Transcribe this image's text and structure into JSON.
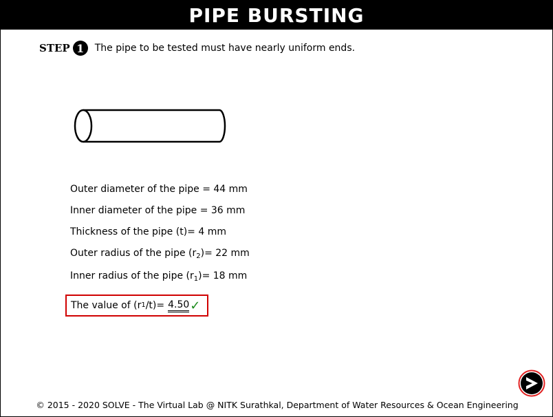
{
  "header": {
    "title": "PIPE BURSTING"
  },
  "step": {
    "word": "STEP",
    "number": "1",
    "instruction": "The pipe to be tested must have nearly uniform ends."
  },
  "parameters": {
    "outer_diameter": "Outer diameter of the pipe = 44 mm",
    "inner_diameter": "Inner diameter of the pipe = 36 mm",
    "thickness": "Thickness of the pipe (t)= 4 mm",
    "outer_radius": {
      "prefix": "Outer radius of the pipe (r",
      "sub": "2",
      "suffix": ")= 22 mm"
    },
    "inner_radius": {
      "prefix": "Inner radius of the pipe (r",
      "sub": "1",
      "suffix": ")= 18 mm"
    }
  },
  "result": {
    "prefix": "The value of (r",
    "sub": "1",
    "suffix": "/t)=",
    "answer": "4.50",
    "status": "correct",
    "check_icon": "checkmark-icon",
    "check_color": "#1a8a1a",
    "box_color": "#d00000"
  },
  "navigation": {
    "next_icon": "arrow-right-circle-icon"
  },
  "footer": {
    "text": "© 2015 - 2020 SOLVE - The Virtual Lab @ NITK Surathkal, Department of Water Resources & Ocean Engineering"
  }
}
